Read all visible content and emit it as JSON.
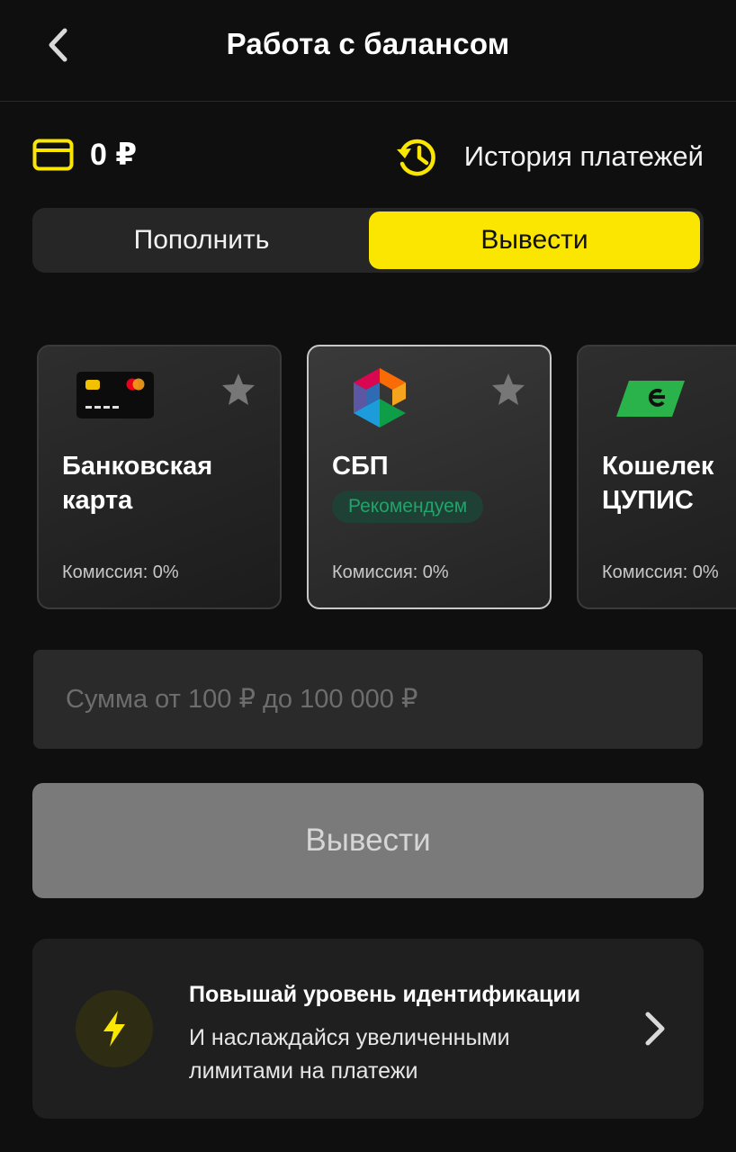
{
  "header": {
    "title": "Работа с балансом"
  },
  "balance": {
    "amount": "0 ₽",
    "history_label": "История платежей"
  },
  "tabs": [
    {
      "label": "Пополнить",
      "active": false
    },
    {
      "label": "Вывести",
      "active": true
    }
  ],
  "methods": [
    {
      "name_line1": "Банковская",
      "name_line2": "карта",
      "badge": "",
      "fee": "Комиссия: 0%",
      "icon": "bank-card-icon",
      "selected": false
    },
    {
      "name_line1": "СБП",
      "name_line2": "",
      "badge": "Рекомендуем",
      "fee": "Комиссия: 0%",
      "icon": "sbp-logo-icon",
      "selected": true
    },
    {
      "name_line1": "Кошелек",
      "name_line2": "ЦУПИС",
      "badge": "",
      "fee": "Комиссия: 0%",
      "icon": "cupis-logo-icon",
      "selected": false
    }
  ],
  "amount_input": {
    "placeholder": "Сумма от 100 ₽ до 100 000 ₽",
    "value": ""
  },
  "submit": {
    "label": "Вывести"
  },
  "promo": {
    "title": "Повышай уровень идентификации",
    "text": "И наслаждайся увеличенными лимитами на платежи"
  },
  "colors": {
    "accent": "#fae600",
    "background": "#0f0f0f",
    "badge_green": "#21a46b"
  }
}
